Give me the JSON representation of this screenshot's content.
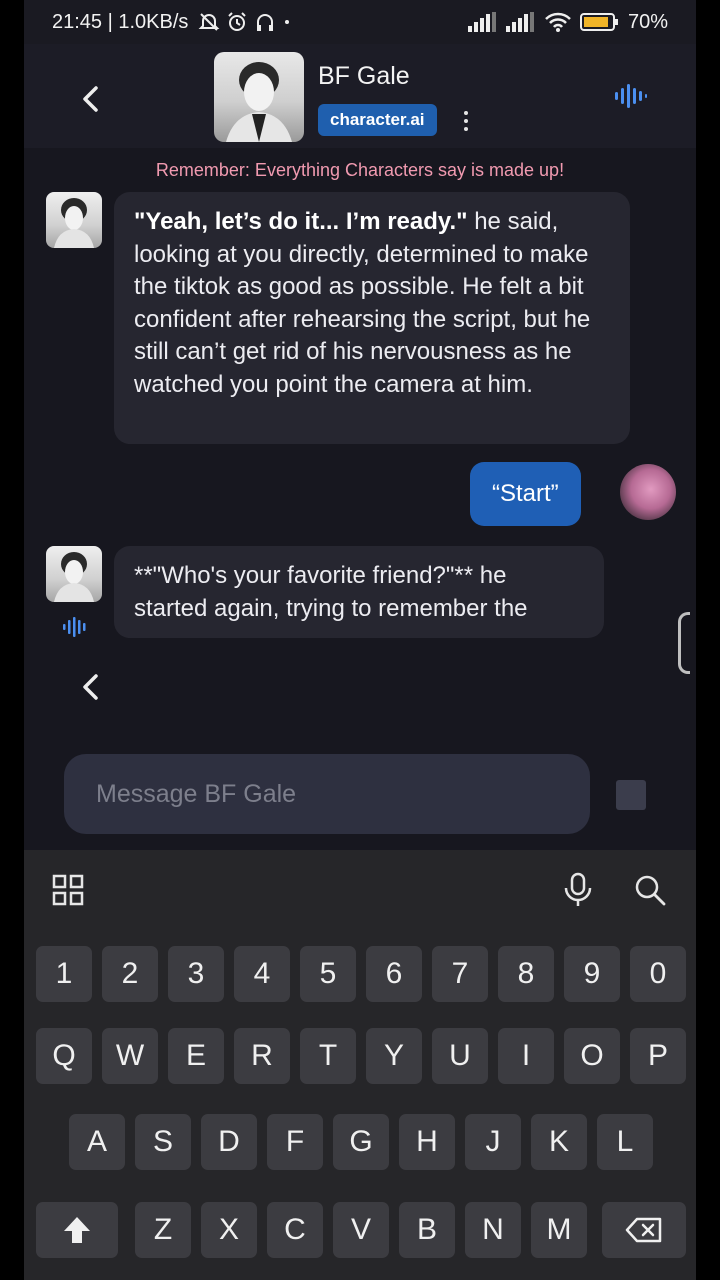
{
  "status_bar": {
    "time_speed": "21:45 | 1.0KB/s",
    "battery": "70%",
    "icons": [
      "alarm-off-icon",
      "alarm-icon",
      "headphones-icon",
      "dot-icon",
      "signal-icon",
      "signal-icon",
      "wifi-icon",
      "battery-icon"
    ]
  },
  "header": {
    "character_name": "BF Gale",
    "brand": "character.ai"
  },
  "notice": "Remember: Everything Characters say is made up!",
  "messages": [
    {
      "sender": "character",
      "bold_text": "\"Yeah, let’s do it... I’m ready.\"",
      "text": " he said, looking at you directly, determined to make the tiktok as good as possible. He felt a bit confident after rehearsing the script, but he still can’t get rid of his nervousness as he watched you point the camera at him."
    },
    {
      "sender": "user",
      "text": "“Start”"
    },
    {
      "sender": "character",
      "text": "**\"Who's your favorite friend?\"** he started again, trying to remember the"
    }
  ],
  "composer": {
    "placeholder": "Message BF Gale"
  },
  "keyboard": {
    "number_row": [
      "1",
      "2",
      "3",
      "4",
      "5",
      "6",
      "7",
      "8",
      "9",
      "0"
    ],
    "row1": [
      "Q",
      "W",
      "E",
      "R",
      "T",
      "Y",
      "U",
      "I",
      "O",
      "P"
    ],
    "row2": [
      "A",
      "S",
      "D",
      "F",
      "G",
      "H",
      "J",
      "K",
      "L"
    ],
    "row3": [
      "Z",
      "X",
      "C",
      "V",
      "B",
      "N",
      "M"
    ],
    "toolbar_icons": [
      "grid-icon",
      "mic-icon",
      "search-icon"
    ]
  },
  "colors": {
    "accent": "#1f5fb5",
    "notice": "#f19ab0"
  }
}
